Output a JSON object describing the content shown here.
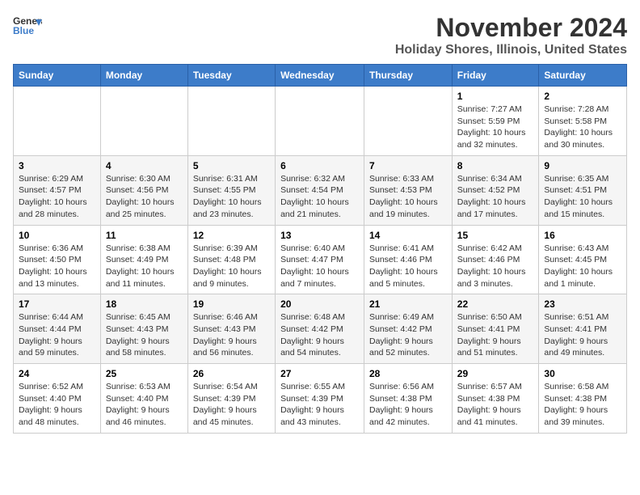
{
  "header": {
    "logo_line1": "General",
    "logo_line2": "Blue",
    "month": "November 2024",
    "location": "Holiday Shores, Illinois, United States"
  },
  "weekdays": [
    "Sunday",
    "Monday",
    "Tuesday",
    "Wednesday",
    "Thursday",
    "Friday",
    "Saturday"
  ],
  "weeks": [
    [
      {
        "day": "",
        "info": ""
      },
      {
        "day": "",
        "info": ""
      },
      {
        "day": "",
        "info": ""
      },
      {
        "day": "",
        "info": ""
      },
      {
        "day": "",
        "info": ""
      },
      {
        "day": "1",
        "info": "Sunrise: 7:27 AM\nSunset: 5:59 PM\nDaylight: 10 hours and 32 minutes."
      },
      {
        "day": "2",
        "info": "Sunrise: 7:28 AM\nSunset: 5:58 PM\nDaylight: 10 hours and 30 minutes."
      }
    ],
    [
      {
        "day": "3",
        "info": "Sunrise: 6:29 AM\nSunset: 4:57 PM\nDaylight: 10 hours and 28 minutes."
      },
      {
        "day": "4",
        "info": "Sunrise: 6:30 AM\nSunset: 4:56 PM\nDaylight: 10 hours and 25 minutes."
      },
      {
        "day": "5",
        "info": "Sunrise: 6:31 AM\nSunset: 4:55 PM\nDaylight: 10 hours and 23 minutes."
      },
      {
        "day": "6",
        "info": "Sunrise: 6:32 AM\nSunset: 4:54 PM\nDaylight: 10 hours and 21 minutes."
      },
      {
        "day": "7",
        "info": "Sunrise: 6:33 AM\nSunset: 4:53 PM\nDaylight: 10 hours and 19 minutes."
      },
      {
        "day": "8",
        "info": "Sunrise: 6:34 AM\nSunset: 4:52 PM\nDaylight: 10 hours and 17 minutes."
      },
      {
        "day": "9",
        "info": "Sunrise: 6:35 AM\nSunset: 4:51 PM\nDaylight: 10 hours and 15 minutes."
      }
    ],
    [
      {
        "day": "10",
        "info": "Sunrise: 6:36 AM\nSunset: 4:50 PM\nDaylight: 10 hours and 13 minutes."
      },
      {
        "day": "11",
        "info": "Sunrise: 6:38 AM\nSunset: 4:49 PM\nDaylight: 10 hours and 11 minutes."
      },
      {
        "day": "12",
        "info": "Sunrise: 6:39 AM\nSunset: 4:48 PM\nDaylight: 10 hours and 9 minutes."
      },
      {
        "day": "13",
        "info": "Sunrise: 6:40 AM\nSunset: 4:47 PM\nDaylight: 10 hours and 7 minutes."
      },
      {
        "day": "14",
        "info": "Sunrise: 6:41 AM\nSunset: 4:46 PM\nDaylight: 10 hours and 5 minutes."
      },
      {
        "day": "15",
        "info": "Sunrise: 6:42 AM\nSunset: 4:46 PM\nDaylight: 10 hours and 3 minutes."
      },
      {
        "day": "16",
        "info": "Sunrise: 6:43 AM\nSunset: 4:45 PM\nDaylight: 10 hours and 1 minute."
      }
    ],
    [
      {
        "day": "17",
        "info": "Sunrise: 6:44 AM\nSunset: 4:44 PM\nDaylight: 9 hours and 59 minutes."
      },
      {
        "day": "18",
        "info": "Sunrise: 6:45 AM\nSunset: 4:43 PM\nDaylight: 9 hours and 58 minutes."
      },
      {
        "day": "19",
        "info": "Sunrise: 6:46 AM\nSunset: 4:43 PM\nDaylight: 9 hours and 56 minutes."
      },
      {
        "day": "20",
        "info": "Sunrise: 6:48 AM\nSunset: 4:42 PM\nDaylight: 9 hours and 54 minutes."
      },
      {
        "day": "21",
        "info": "Sunrise: 6:49 AM\nSunset: 4:42 PM\nDaylight: 9 hours and 52 minutes."
      },
      {
        "day": "22",
        "info": "Sunrise: 6:50 AM\nSunset: 4:41 PM\nDaylight: 9 hours and 51 minutes."
      },
      {
        "day": "23",
        "info": "Sunrise: 6:51 AM\nSunset: 4:41 PM\nDaylight: 9 hours and 49 minutes."
      }
    ],
    [
      {
        "day": "24",
        "info": "Sunrise: 6:52 AM\nSunset: 4:40 PM\nDaylight: 9 hours and 48 minutes."
      },
      {
        "day": "25",
        "info": "Sunrise: 6:53 AM\nSunset: 4:40 PM\nDaylight: 9 hours and 46 minutes."
      },
      {
        "day": "26",
        "info": "Sunrise: 6:54 AM\nSunset: 4:39 PM\nDaylight: 9 hours and 45 minutes."
      },
      {
        "day": "27",
        "info": "Sunrise: 6:55 AM\nSunset: 4:39 PM\nDaylight: 9 hours and 43 minutes."
      },
      {
        "day": "28",
        "info": "Sunrise: 6:56 AM\nSunset: 4:38 PM\nDaylight: 9 hours and 42 minutes."
      },
      {
        "day": "29",
        "info": "Sunrise: 6:57 AM\nSunset: 4:38 PM\nDaylight: 9 hours and 41 minutes."
      },
      {
        "day": "30",
        "info": "Sunrise: 6:58 AM\nSunset: 4:38 PM\nDaylight: 9 hours and 39 minutes."
      }
    ]
  ]
}
